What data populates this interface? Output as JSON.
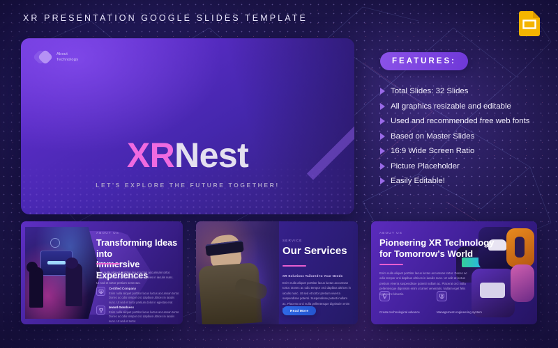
{
  "header": {
    "title": "XR PRESENTATION GOOGLE SLIDES TEMPLATE",
    "app_icon": "google-slides-icon"
  },
  "hero": {
    "logo": {
      "line1": "About",
      "line2": "Technology",
      "mark": "diamond-logo-mark"
    },
    "title_accent": "XR",
    "title_rest": "Nest",
    "tagline": "LET'S EXPLORE THE FUTURE TOGETHER!"
  },
  "features": {
    "badge": "FEATURES:",
    "items": [
      "Total Slides: 32 Slides",
      "All graphics resizable and editable",
      "Used and recommended free web fonts",
      "Based on Master Slides",
      "16:9 Wide Screen Ratio",
      "Picture Placeholder",
      "Easily Editable!"
    ]
  },
  "thumbnails": [
    {
      "label": "ABOUT US",
      "title_line1": "Transforming Ideas into",
      "title_line2": "Immersive Experiences",
      "body": "Enim nulla aliquet porttitor lacus luctus accumsan tortor. Donec ac odio tempor orci dapibus ultrices in iaculis nunc. Ut sed et tortor pretium senectus.",
      "feature_blocks": [
        {
          "icon": "certificate-icon",
          "title": "Certified Company",
          "text": "Enim nulla aliquet porttitor lacus luctus accumsan tortor. Donec ac odio tempor orci dapibus ultrices in iaculis nunc. Ut sed et tortor pretium dolor in egestas erat pretium auctor."
        },
        {
          "icon": "trophy-icon",
          "title": "Award Goodness",
          "text": "Enim nulla aliquet porttitor lacus luctus accumsan tortor. Donec ac odio tempor orci dapibus ultrices in iaculis nunc. Ut sed et tortor."
        }
      ]
    },
    {
      "label": "SERVICE",
      "title_line1": "Our Services",
      "subheading": "XR Solutions Tailored to Your Needs",
      "body": "Enim nulla aliquet porttitor lacus luctus accumsan tortor. Donec ac odio tempor orci dapibus ultrices in iaculis nunc. Ut sed et tortor pretium viverra suspendisse potenti. Suspendisse potenti nullam ac. Placerat orci nulla pellentesque dignissim enim ut aliquam venenatis.",
      "button": "Read More"
    },
    {
      "label": "ABOUT US",
      "title_line1": "Pioneering XR Technology",
      "title_line2": "for Tomorrow's World",
      "body": "Enim nulla aliquet porttitor lacus luctus accumsan tortor. Donec ac odio tempor orci dapibus ultrices in iaculis nunc. Ut velit at lectus pretium viverra suspendisse potenti nullam ac. Placerat orci nulla pellentesque dignissim enim ut amet venenatis. Nullam eget felis eget nunc lobortis.",
      "captions": [
        {
          "icon": "lightbulb-icon",
          "text": "Create technological advance"
        },
        {
          "icon": "gear-engineering-icon",
          "text": "Management engineering system"
        }
      ]
    }
  ],
  "colors": {
    "accent_pink": "#f06ae0",
    "accent_purple": "#8b52e8",
    "button_blue": "#2f6ae8",
    "slides_yellow": "#f4b400",
    "background": "#1a1446"
  }
}
